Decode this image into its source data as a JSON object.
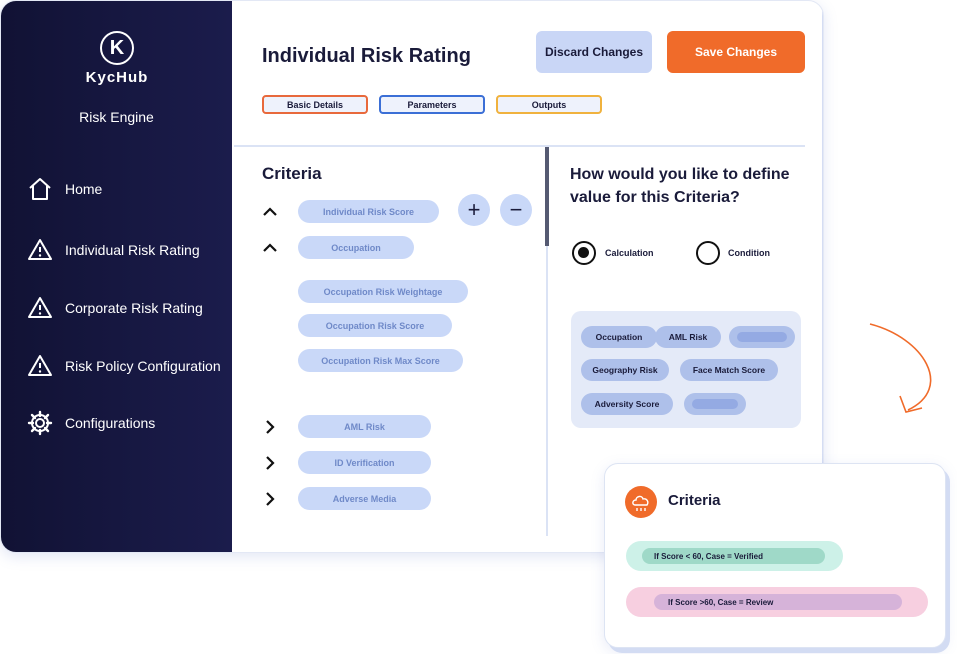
{
  "brand": {
    "name": "KycHub",
    "mark_letter": "K",
    "product": "Risk Engine"
  },
  "sidebar": {
    "items": [
      {
        "label": "Home",
        "icon": "home-icon"
      },
      {
        "label": "Individual Risk Rating",
        "icon": "warning-icon"
      },
      {
        "label": "Corporate Risk Rating",
        "icon": "warning-icon"
      },
      {
        "label": "Risk Policy Configuration",
        "icon": "warning-icon"
      },
      {
        "label": "Configurations",
        "icon": "gear-icon"
      }
    ]
  },
  "header": {
    "title": "Individual Risk Rating",
    "discard_label": "Discard Changes",
    "save_label": "Save Changes"
  },
  "tabs": [
    {
      "label": "Basic Details",
      "color": "#e8693c"
    },
    {
      "label": "Parameters",
      "color": "#3b6fd6"
    },
    {
      "label": "Outputs",
      "color": "#f0b23e"
    }
  ],
  "criteria": {
    "title": "Criteria",
    "add_symbol": "+",
    "remove_symbol": "−",
    "tree": [
      {
        "label": "Individual Risk Score",
        "state": "expanded"
      },
      {
        "label": "Occupation",
        "state": "expanded"
      },
      {
        "label": "Occupation Risk Weightage",
        "state": "child"
      },
      {
        "label": "Occupation Risk Score",
        "state": "child"
      },
      {
        "label": "Occupation Risk Max Score",
        "state": "child"
      },
      {
        "label": "AML Risk",
        "state": "collapsed"
      },
      {
        "label": "ID Verification",
        "state": "collapsed"
      },
      {
        "label": "Adverse Media",
        "state": "collapsed"
      }
    ]
  },
  "definition": {
    "question": "How would you like to define value for this Criteria?",
    "options": [
      {
        "label": "Calculation",
        "selected": true
      },
      {
        "label": "Condition",
        "selected": false
      }
    ],
    "chips": [
      "Occupation",
      "AML Risk",
      "Geography Risk",
      "Face Match Score",
      "Adversity Score"
    ]
  },
  "card": {
    "title": "Criteria",
    "rules": [
      "If Score < 60, Case = Verified",
      "If Score >60, Case = Review"
    ]
  },
  "colors": {
    "accent": "#f06b2a",
    "sidebar": "#15163e",
    "pill": "#c9d8f8"
  }
}
